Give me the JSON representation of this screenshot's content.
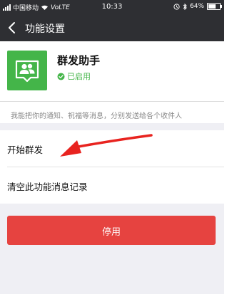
{
  "status_bar": {
    "carrier": "中国移动",
    "network": "VoLTE",
    "time": "10:33",
    "battery": "64%"
  },
  "nav": {
    "title": "功能设置",
    "back_icon": "chevron-left-icon"
  },
  "app": {
    "name": "群发助手",
    "status": "已启用",
    "icon": "group-chat-icon",
    "description": "我能把你的通知、祝福等消息，分别发送给各个收件人"
  },
  "actions": [
    {
      "label": "开始群发"
    },
    {
      "label": "清空此功能消息记录"
    }
  ],
  "stop_button": {
    "label": "停用"
  },
  "colors": {
    "bar": "#2e2f33",
    "page_bg": "#efeff4",
    "brand_green": "#44b549",
    "danger_red": "#e64340",
    "annotation_red": "#e8231f"
  }
}
